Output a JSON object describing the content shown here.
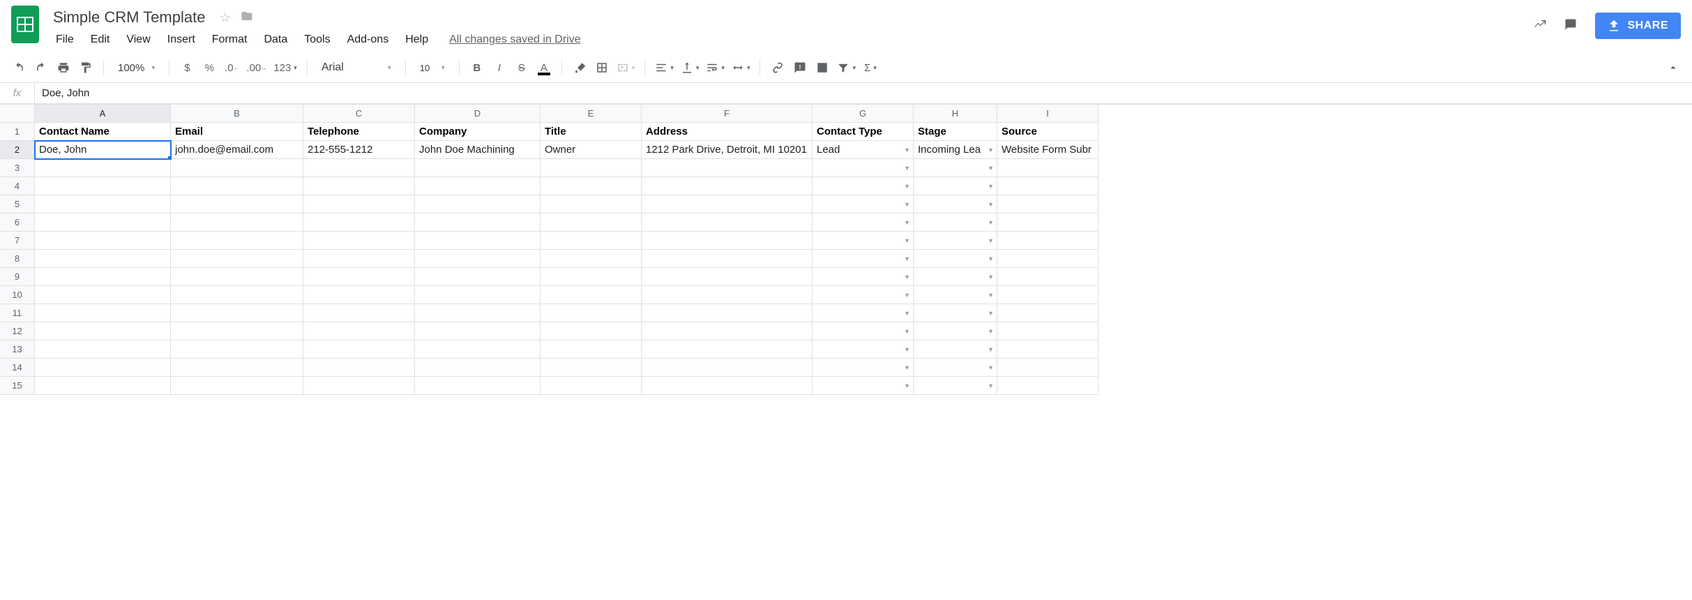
{
  "doc": {
    "title": "Simple CRM Template",
    "drive_status": "All changes saved in Drive"
  },
  "menu": [
    "File",
    "Edit",
    "View",
    "Insert",
    "Format",
    "Data",
    "Tools",
    "Add-ons",
    "Help"
  ],
  "share_label": "SHARE",
  "toolbar": {
    "zoom": "100%",
    "font_name": "Arial",
    "font_size": "10"
  },
  "formula_bar": {
    "value": "Doe, John"
  },
  "columns": [
    "A",
    "B",
    "C",
    "D",
    "E",
    "F",
    "G",
    "H",
    "I"
  ],
  "sheet": {
    "headers": [
      "Contact Name",
      "Email",
      "Telephone",
      "Company",
      "Title",
      "Address",
      "Contact Type",
      "Stage",
      "Source"
    ],
    "dropdown_cols": [
      6,
      7
    ],
    "rows": [
      [
        "Doe, John",
        "john.doe@email.com",
        "212-555-1212",
        "John Doe Machining",
        "Owner",
        "1212 Park Drive, Detroit, MI 10201",
        "Lead",
        "Incoming Lea",
        "Website Form Subr"
      ],
      [
        "",
        "",
        "",
        "",
        "",
        "",
        "",
        "",
        ""
      ],
      [
        "",
        "",
        "",
        "",
        "",
        "",
        "",
        "",
        ""
      ],
      [
        "",
        "",
        "",
        "",
        "",
        "",
        "",
        "",
        ""
      ],
      [
        "",
        "",
        "",
        "",
        "",
        "",
        "",
        "",
        ""
      ],
      [
        "",
        "",
        "",
        "",
        "",
        "",
        "",
        "",
        ""
      ],
      [
        "",
        "",
        "",
        "",
        "",
        "",
        "",
        "",
        ""
      ],
      [
        "",
        "",
        "",
        "",
        "",
        "",
        "",
        "",
        ""
      ],
      [
        "",
        "",
        "",
        "",
        "",
        "",
        "",
        "",
        ""
      ],
      [
        "",
        "",
        "",
        "",
        "",
        "",
        "",
        "",
        ""
      ],
      [
        "",
        "",
        "",
        "",
        "",
        "",
        "",
        "",
        ""
      ],
      [
        "",
        "",
        "",
        "",
        "",
        "",
        "",
        "",
        ""
      ],
      [
        "",
        "",
        "",
        "",
        "",
        "",
        "",
        "",
        ""
      ],
      [
        "",
        "",
        "",
        "",
        "",
        "",
        "",
        "",
        ""
      ]
    ],
    "selected": {
      "row": 0,
      "col": 0
    }
  }
}
